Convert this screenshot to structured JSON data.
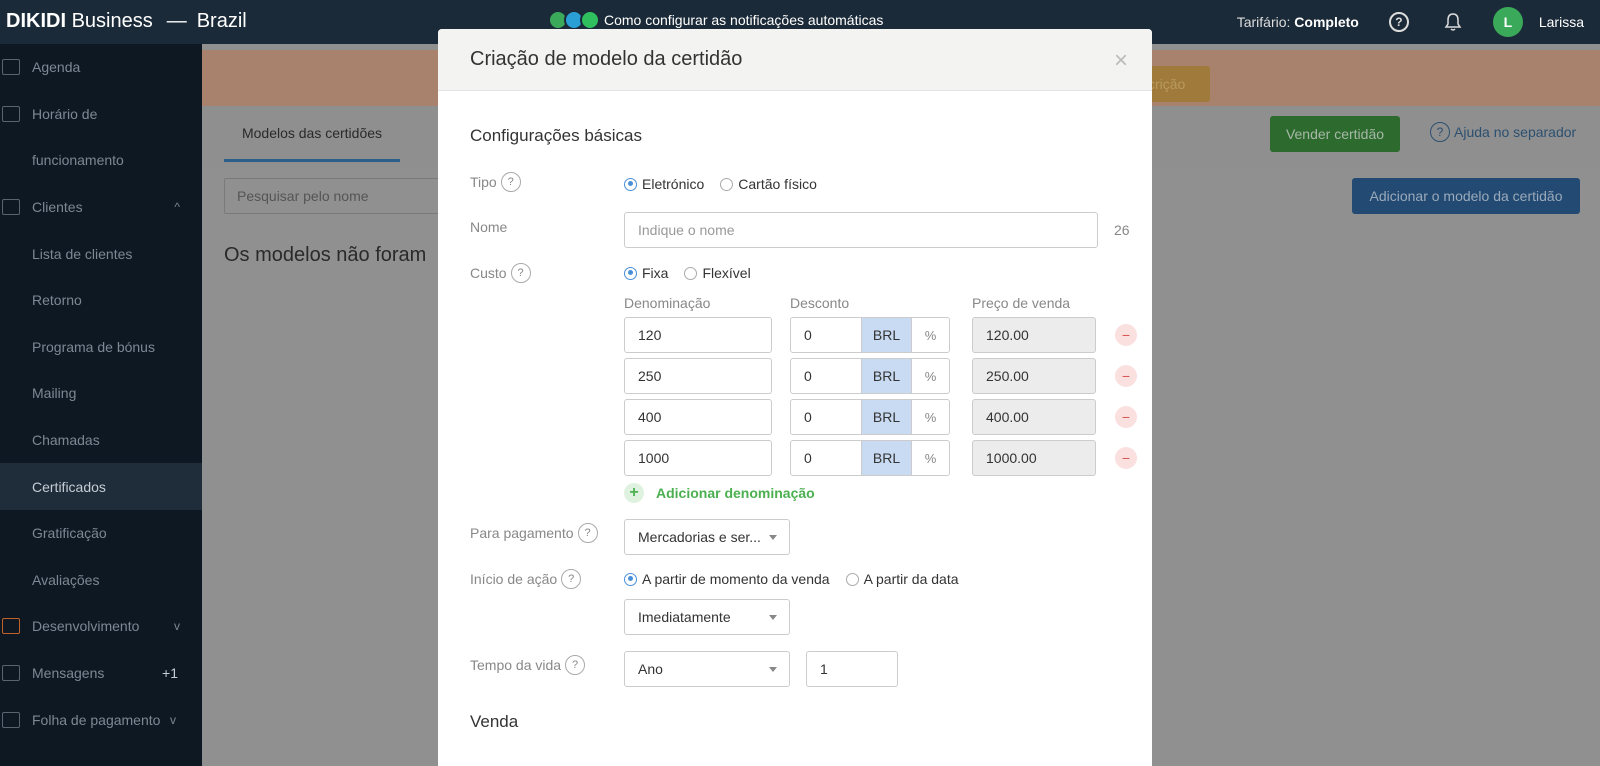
{
  "topbar": {
    "brand_bold": "DIKIDI",
    "brand_rest": "Business",
    "dash": "—",
    "region": "Brazil",
    "promo_text": "Como configurar as notificações automáticas",
    "tariff_label": "Tarifário:",
    "tariff_value": "Completo",
    "help_symbol": "?",
    "avatar_letter": "L",
    "username": "Larissa"
  },
  "sidebar": {
    "items": [
      {
        "label": "Agenda"
      },
      {
        "label": "Horário de"
      },
      {
        "label": "funcionamento"
      },
      {
        "label": "Clientes",
        "chevron": "^"
      },
      {
        "label": "Lista de clientes"
      },
      {
        "label": "Retorno"
      },
      {
        "label": "Programa de bónus"
      },
      {
        "label": "Mailing"
      },
      {
        "label": "Chamadas"
      },
      {
        "label": "Certificados"
      },
      {
        "label": "Gratificação"
      },
      {
        "label": "Avaliações"
      },
      {
        "label": "Desenvolvimento",
        "chevron": "v"
      },
      {
        "label": "Mensagens",
        "badge": "+1"
      },
      {
        "label": "Folha de pagamento",
        "chevron": "v"
      }
    ]
  },
  "main": {
    "orange_btn": "crição",
    "tab_active": "Modelos das certidões",
    "sell_button": "Vender certidão",
    "help_link": "Ajuda no separador",
    "help_symbol": "?",
    "search_placeholder": "Pesquisar pelo nome",
    "add_button": "Adicionar o modelo da certidão",
    "heading": "Os modelos não foram"
  },
  "modal": {
    "title": "Criação de modelo da certidão",
    "close": "×",
    "section_basic": "Configurações básicas",
    "section_sale": "Venda",
    "q": "?",
    "tipo": {
      "label": "Tipo",
      "options": [
        "Eletrónico",
        "Cartão físico"
      ],
      "selected": 0
    },
    "nome": {
      "label": "Nome",
      "placeholder": "Indique o nome",
      "counter": "26"
    },
    "custo": {
      "label": "Custo",
      "options": [
        "Fixa",
        "Flexível"
      ],
      "selected": 0
    },
    "columns": {
      "denom": "Denominação",
      "discount": "Desconto",
      "price": "Preço de venda"
    },
    "currency": "BRL",
    "percent": "%",
    "remove_symbol": "−",
    "rows": [
      {
        "denom": "120",
        "discount": "0",
        "price": "120.00"
      },
      {
        "denom": "250",
        "discount": "0",
        "price": "250.00"
      },
      {
        "denom": "400",
        "discount": "0",
        "price": "400.00"
      },
      {
        "denom": "1000",
        "discount": "0",
        "price": "1000.00"
      }
    ],
    "add_denom": "Adicionar denominação",
    "add_symbol": "+",
    "payment": {
      "label": "Para pagamento",
      "value": "Mercadorias e ser..."
    },
    "start": {
      "label": "Início de ação",
      "options": [
        "A partir de momento da venda",
        "A partir da data"
      ],
      "selected": 0,
      "select_value": "Imediatamente"
    },
    "lifetime": {
      "label": "Tempo da vida",
      "unit": "Ano",
      "value": "1"
    }
  }
}
